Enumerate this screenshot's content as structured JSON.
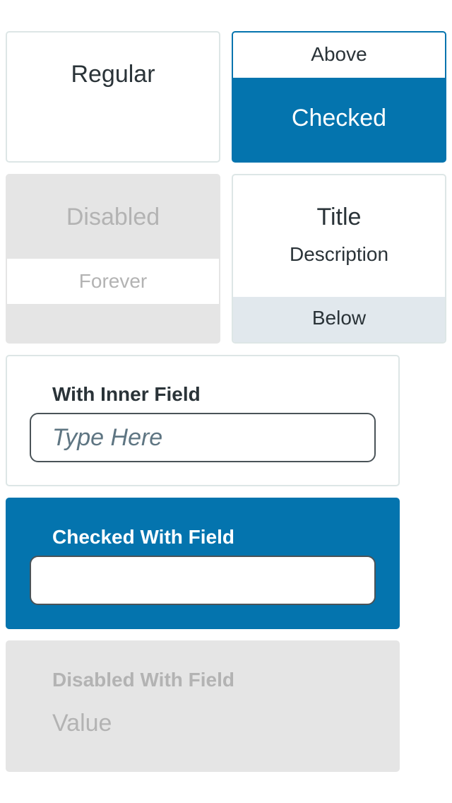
{
  "cards": {
    "regular": {
      "label": "Regular"
    },
    "checked": {
      "above": "Above",
      "label": "Checked"
    },
    "disabled": {
      "label": "Disabled",
      "sublabel": "Forever"
    },
    "title_desc": {
      "title": "Title",
      "description": "Description",
      "below": "Below"
    }
  },
  "field_cards": {
    "inner": {
      "heading": "With Inner Field",
      "placeholder": "Type Here",
      "value": ""
    },
    "checked": {
      "heading": "Checked With Field",
      "value": ""
    },
    "disabled": {
      "heading": "Disabled With Field",
      "value": "Value"
    }
  },
  "colors": {
    "accent": "#0474ae",
    "disabled_bg": "#e5e5e5",
    "below_band": "#e1e8ed",
    "border": "#dde6e6"
  }
}
